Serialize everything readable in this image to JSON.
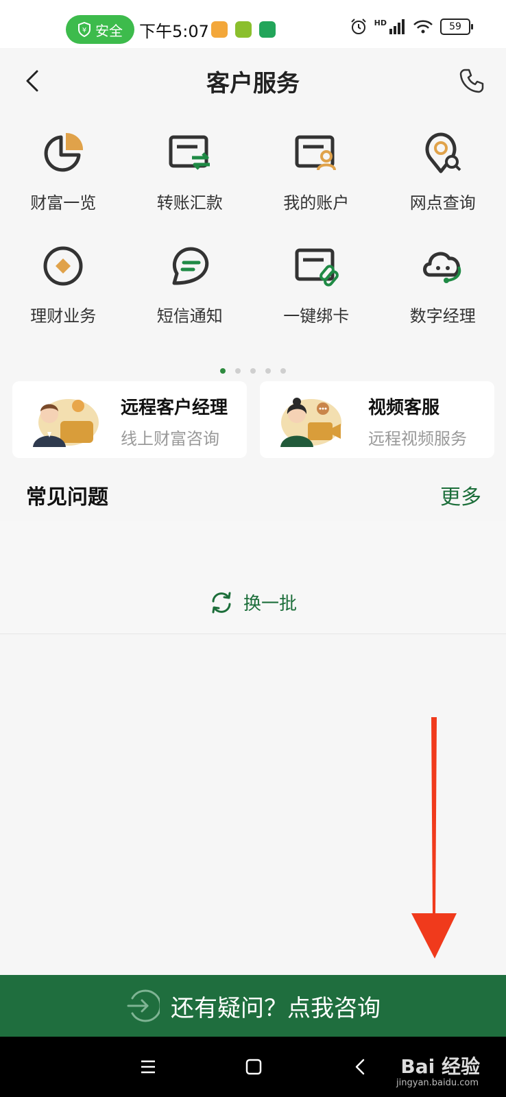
{
  "status_bar": {
    "safe_label": "安全",
    "time": "下午5:07",
    "signal_label": "HD",
    "battery": "59"
  },
  "header": {
    "title": "客户服务",
    "back_icon": "chevron-left-icon",
    "phone_icon": "phone-icon"
  },
  "grid": {
    "row1": [
      {
        "label": "财富一览",
        "icon": "pie-chart-icon"
      },
      {
        "label": "转账汇款",
        "icon": "transfer-card-icon"
      },
      {
        "label": "我的账户",
        "icon": "account-card-icon"
      },
      {
        "label": "网点查询",
        "icon": "location-search-icon"
      }
    ],
    "row2": [
      {
        "label": "理财业务",
        "icon": "diamond-circle-icon"
      },
      {
        "label": "短信通知",
        "icon": "message-bubble-icon"
      },
      {
        "label": "一键绑卡",
        "icon": "link-card-icon"
      },
      {
        "label": "数字经理",
        "icon": "cloud-assistant-icon"
      }
    ],
    "page_count": 5,
    "active_page": 1
  },
  "service_cards": [
    {
      "title": "远程客户经理",
      "subtitle": "线上财富咨询"
    },
    {
      "title": "视频客服",
      "subtitle": "远程视频服务"
    }
  ],
  "faq": {
    "title": "常见问题",
    "more_label": "更多",
    "refresh_label": "换一批"
  },
  "consult": {
    "label": "还有疑问？点我咨询"
  },
  "navbar": {
    "watermark": "Bai 经验",
    "watermark_url": "jingyan.baidu.com"
  },
  "colors": {
    "brand_green": "#1f6e3e",
    "accent_orange": "#e0a24a",
    "safe_green": "#3dbb4c",
    "annotation_red": "#f03a1c"
  }
}
